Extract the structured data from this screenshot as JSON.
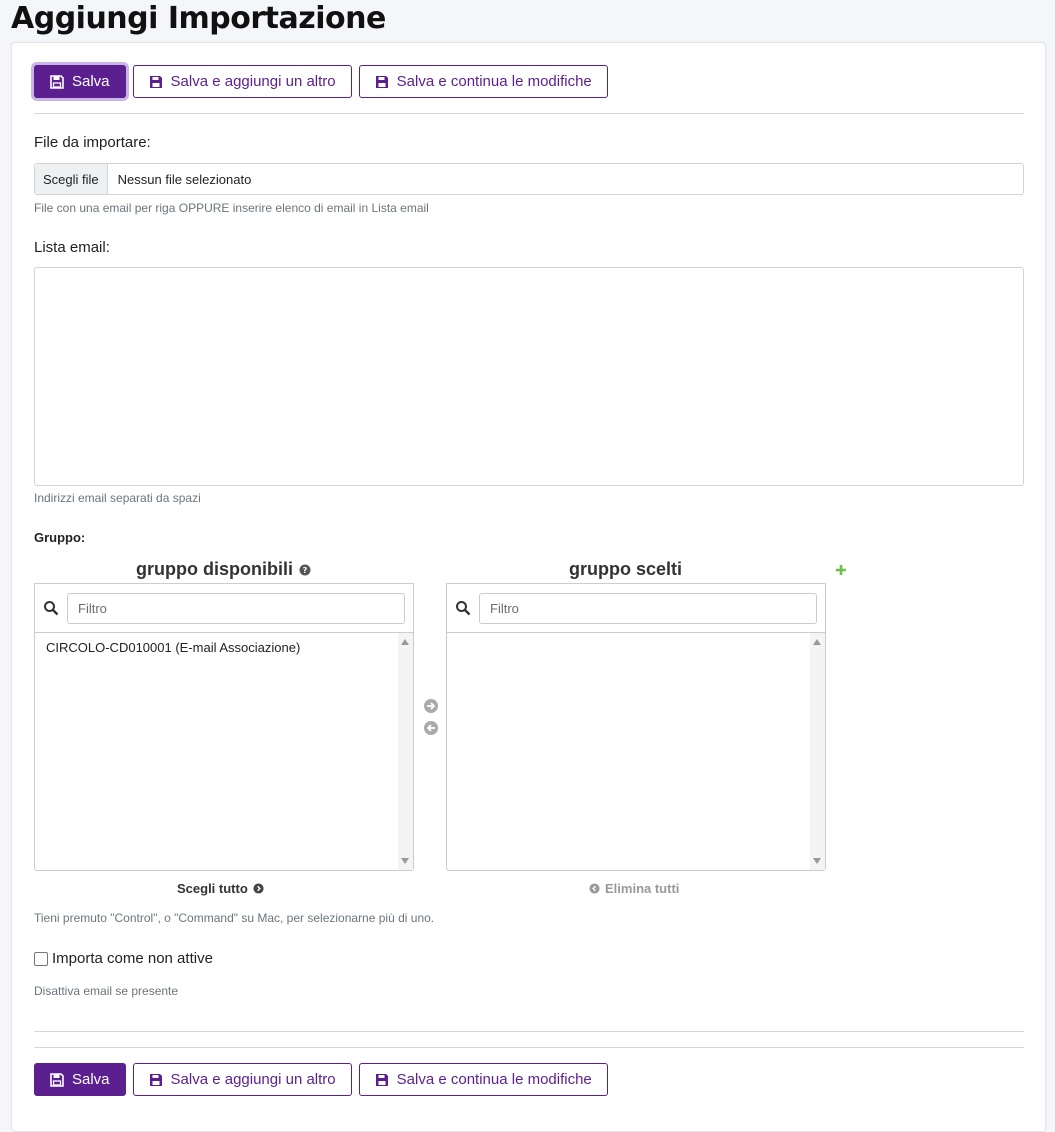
{
  "page": {
    "title": "Aggiungi Importazione"
  },
  "buttons": {
    "save": "Salva",
    "save_add": "Salva e aggiungi un altro",
    "save_continue": "Salva e continua le modifiche"
  },
  "file": {
    "label": "File da importare:",
    "button": "Scegli file",
    "status": "Nessun file selezionato",
    "help": "File con una email per riga OPPURE inserire elenco di email in Lista email"
  },
  "email_list": {
    "label": "Lista email:",
    "value": "",
    "help": "Indirizzi email separati da spazi"
  },
  "group": {
    "label": "Gruppo:",
    "available_title": "gruppo disponibili",
    "chosen_title": "gruppo scelti",
    "filter_placeholder": "Filtro",
    "available_options": [
      "CIRCOLO-CD010001 (E-mail Associazione)"
    ],
    "chosen_options": [],
    "choose_all": "Scegli tutto",
    "remove_all": "Elimina tutti",
    "help": "Tieni premuto \"Control\", o \"Command\" su Mac, per selezionarne più di uno."
  },
  "inactive": {
    "label": "Importa come non attive",
    "checked": false,
    "help": "Disattiva email se presente"
  },
  "colors": {
    "accent": "#5c1f8f",
    "add_icon": "#6cc04a"
  },
  "icons": {
    "save": "save-icon",
    "search": "search-icon",
    "help": "help-icon",
    "add": "plus-icon",
    "move_right": "arrow-circle-right-icon",
    "move_left": "arrow-circle-left-icon"
  }
}
